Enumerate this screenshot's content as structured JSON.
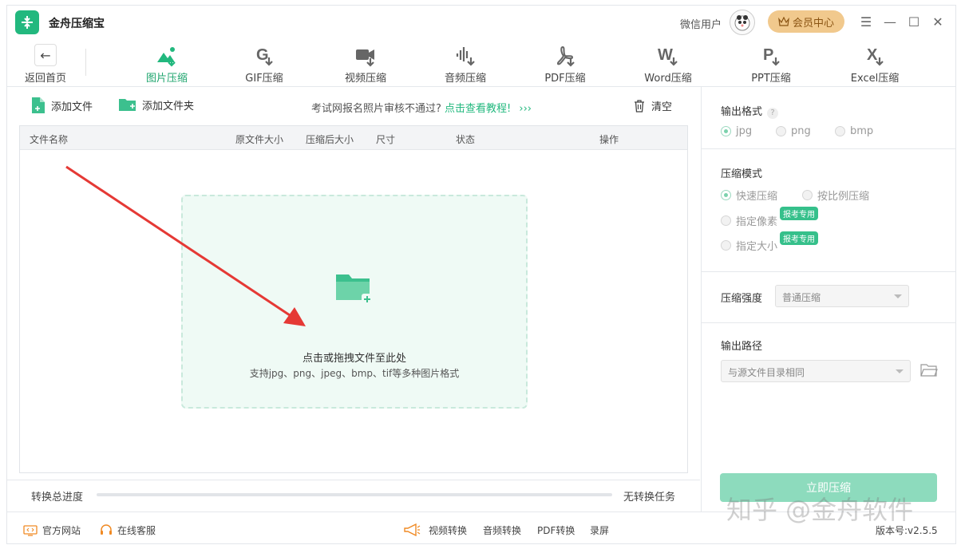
{
  "app": {
    "title": "金舟压缩宝",
    "user_name": "微信用户",
    "vip_label": "会员中心"
  },
  "toolbar": {
    "back_label": "返回首页",
    "tools": [
      {
        "label": "图片压缩",
        "icon": "image-icon",
        "active": true
      },
      {
        "label": "GIF压缩",
        "icon": "gif-icon"
      },
      {
        "label": "视频压缩",
        "icon": "video-icon"
      },
      {
        "label": "音频压缩",
        "icon": "audio-icon"
      },
      {
        "label": "PDF压缩",
        "icon": "pdf-icon"
      },
      {
        "label": "Word压缩",
        "icon": "word-icon"
      },
      {
        "label": "PPT压缩",
        "icon": "ppt-icon"
      },
      {
        "label": "Excel压缩",
        "icon": "excel-icon"
      }
    ]
  },
  "actions": {
    "add_file": "添加文件",
    "add_folder": "添加文件夹",
    "notice_text": "考试网报名照片审核不通过?",
    "notice_link": "点击查看教程!",
    "notice_chevron": "›››",
    "clear": "清空"
  },
  "table": {
    "headers": {
      "name": "文件名称",
      "orig_size": "原文件大小",
      "new_size": "压缩后大小",
      "dims": "尺寸",
      "status": "状态",
      "ops": "操作"
    }
  },
  "dropzone": {
    "main": "点击或拖拽文件至此处",
    "sub": "支持jpg、png、jpeg、bmp、tif等多种图片格式"
  },
  "progress": {
    "label": "转换总进度",
    "value": 0,
    "status": "无转换任务"
  },
  "settings": {
    "output_format": {
      "title": "输出格式",
      "help": "?",
      "options": [
        "jpg",
        "png",
        "bmp"
      ],
      "selected": "jpg"
    },
    "mode": {
      "title": "压缩模式",
      "options": [
        "快速压缩",
        "按比例压缩",
        "指定像素",
        "指定大小"
      ],
      "selected": "快速压缩",
      "tag": "报考专用"
    },
    "strength": {
      "title": "压缩强度",
      "value": "普通压缩"
    },
    "output_path": {
      "title": "输出路径",
      "value": "与源文件目录相同"
    },
    "compress_button": "立即压缩"
  },
  "footer": {
    "website": "官方网站",
    "support": "在线客服",
    "video_convert": "视频转换",
    "audio_convert": "音频转换",
    "pdf_convert": "PDF转换",
    "record": "录屏",
    "version": "版本号:v2.5.5"
  },
  "watermark": "知乎 @金舟软件",
  "colors": {
    "accent": "#22b87e",
    "vip": "#f1c98d",
    "arrow": "#e53935"
  }
}
